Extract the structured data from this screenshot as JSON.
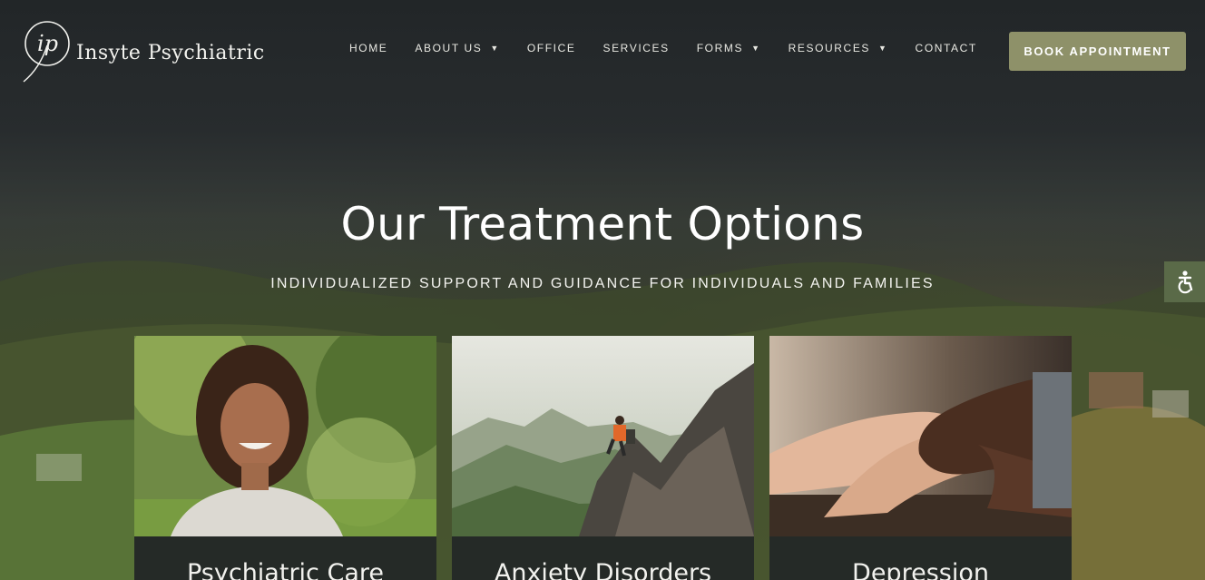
{
  "brand": {
    "name": "Insyte Psychiatric",
    "monogram": "ip"
  },
  "nav": {
    "items": [
      {
        "label": "HOME",
        "has_dropdown": false
      },
      {
        "label": "ABOUT US",
        "has_dropdown": true
      },
      {
        "label": "OFFICE",
        "has_dropdown": false
      },
      {
        "label": "SERVICES",
        "has_dropdown": false
      },
      {
        "label": "FORMS",
        "has_dropdown": true
      },
      {
        "label": "RESOURCES",
        "has_dropdown": true
      },
      {
        "label": "CONTACT",
        "has_dropdown": false
      }
    ],
    "caret": "▼"
  },
  "cta": {
    "label": "BOOK APPOINTMENT"
  },
  "hero": {
    "title": "Our Treatment Options",
    "subtitle": "INDIVIDUALIZED SUPPORT AND GUIDANCE FOR INDIVIDUALS AND FAMILIES"
  },
  "cards": [
    {
      "title": "Psychiatric Care",
      "image": "smiling-woman-photo"
    },
    {
      "title": "Anxiety Disorders",
      "image": "hiker-on-mountain-photo"
    },
    {
      "title": "Depression",
      "image": "holding-hands-photo"
    }
  ],
  "accessibility": {
    "icon": "accessibility-icon"
  },
  "colors": {
    "accent": "#8e9169",
    "header_bg": "#222628",
    "card_bg": "#252a27",
    "access_bg": "#5a6a48"
  }
}
